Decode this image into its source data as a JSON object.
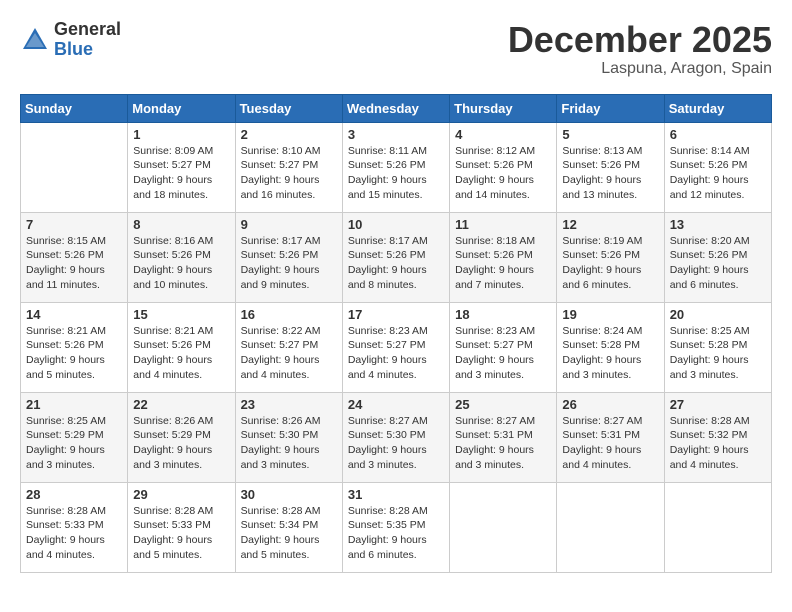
{
  "header": {
    "logo_general": "General",
    "logo_blue": "Blue",
    "month_title": "December 2025",
    "location": "Laspuna, Aragon, Spain"
  },
  "weekdays": [
    "Sunday",
    "Monday",
    "Tuesday",
    "Wednesday",
    "Thursday",
    "Friday",
    "Saturday"
  ],
  "weeks": [
    [
      {
        "day": "",
        "info": ""
      },
      {
        "day": "1",
        "info": "Sunrise: 8:09 AM\nSunset: 5:27 PM\nDaylight: 9 hours\nand 18 minutes."
      },
      {
        "day": "2",
        "info": "Sunrise: 8:10 AM\nSunset: 5:27 PM\nDaylight: 9 hours\nand 16 minutes."
      },
      {
        "day": "3",
        "info": "Sunrise: 8:11 AM\nSunset: 5:26 PM\nDaylight: 9 hours\nand 15 minutes."
      },
      {
        "day": "4",
        "info": "Sunrise: 8:12 AM\nSunset: 5:26 PM\nDaylight: 9 hours\nand 14 minutes."
      },
      {
        "day": "5",
        "info": "Sunrise: 8:13 AM\nSunset: 5:26 PM\nDaylight: 9 hours\nand 13 minutes."
      },
      {
        "day": "6",
        "info": "Sunrise: 8:14 AM\nSunset: 5:26 PM\nDaylight: 9 hours\nand 12 minutes."
      }
    ],
    [
      {
        "day": "7",
        "info": "Sunrise: 8:15 AM\nSunset: 5:26 PM\nDaylight: 9 hours\nand 11 minutes."
      },
      {
        "day": "8",
        "info": "Sunrise: 8:16 AM\nSunset: 5:26 PM\nDaylight: 9 hours\nand 10 minutes."
      },
      {
        "day": "9",
        "info": "Sunrise: 8:17 AM\nSunset: 5:26 PM\nDaylight: 9 hours\nand 9 minutes."
      },
      {
        "day": "10",
        "info": "Sunrise: 8:17 AM\nSunset: 5:26 PM\nDaylight: 9 hours\nand 8 minutes."
      },
      {
        "day": "11",
        "info": "Sunrise: 8:18 AM\nSunset: 5:26 PM\nDaylight: 9 hours\nand 7 minutes."
      },
      {
        "day": "12",
        "info": "Sunrise: 8:19 AM\nSunset: 5:26 PM\nDaylight: 9 hours\nand 6 minutes."
      },
      {
        "day": "13",
        "info": "Sunrise: 8:20 AM\nSunset: 5:26 PM\nDaylight: 9 hours\nand 6 minutes."
      }
    ],
    [
      {
        "day": "14",
        "info": "Sunrise: 8:21 AM\nSunset: 5:26 PM\nDaylight: 9 hours\nand 5 minutes."
      },
      {
        "day": "15",
        "info": "Sunrise: 8:21 AM\nSunset: 5:26 PM\nDaylight: 9 hours\nand 4 minutes."
      },
      {
        "day": "16",
        "info": "Sunrise: 8:22 AM\nSunset: 5:27 PM\nDaylight: 9 hours\nand 4 minutes."
      },
      {
        "day": "17",
        "info": "Sunrise: 8:23 AM\nSunset: 5:27 PM\nDaylight: 9 hours\nand 4 minutes."
      },
      {
        "day": "18",
        "info": "Sunrise: 8:23 AM\nSunset: 5:27 PM\nDaylight: 9 hours\nand 3 minutes."
      },
      {
        "day": "19",
        "info": "Sunrise: 8:24 AM\nSunset: 5:28 PM\nDaylight: 9 hours\nand 3 minutes."
      },
      {
        "day": "20",
        "info": "Sunrise: 8:25 AM\nSunset: 5:28 PM\nDaylight: 9 hours\nand 3 minutes."
      }
    ],
    [
      {
        "day": "21",
        "info": "Sunrise: 8:25 AM\nSunset: 5:29 PM\nDaylight: 9 hours\nand 3 minutes."
      },
      {
        "day": "22",
        "info": "Sunrise: 8:26 AM\nSunset: 5:29 PM\nDaylight: 9 hours\nand 3 minutes."
      },
      {
        "day": "23",
        "info": "Sunrise: 8:26 AM\nSunset: 5:30 PM\nDaylight: 9 hours\nand 3 minutes."
      },
      {
        "day": "24",
        "info": "Sunrise: 8:27 AM\nSunset: 5:30 PM\nDaylight: 9 hours\nand 3 minutes."
      },
      {
        "day": "25",
        "info": "Sunrise: 8:27 AM\nSunset: 5:31 PM\nDaylight: 9 hours\nand 3 minutes."
      },
      {
        "day": "26",
        "info": "Sunrise: 8:27 AM\nSunset: 5:31 PM\nDaylight: 9 hours\nand 4 minutes."
      },
      {
        "day": "27",
        "info": "Sunrise: 8:28 AM\nSunset: 5:32 PM\nDaylight: 9 hours\nand 4 minutes."
      }
    ],
    [
      {
        "day": "28",
        "info": "Sunrise: 8:28 AM\nSunset: 5:33 PM\nDaylight: 9 hours\nand 4 minutes."
      },
      {
        "day": "29",
        "info": "Sunrise: 8:28 AM\nSunset: 5:33 PM\nDaylight: 9 hours\nand 5 minutes."
      },
      {
        "day": "30",
        "info": "Sunrise: 8:28 AM\nSunset: 5:34 PM\nDaylight: 9 hours\nand 5 minutes."
      },
      {
        "day": "31",
        "info": "Sunrise: 8:28 AM\nSunset: 5:35 PM\nDaylight: 9 hours\nand 6 minutes."
      },
      {
        "day": "",
        "info": ""
      },
      {
        "day": "",
        "info": ""
      },
      {
        "day": "",
        "info": ""
      }
    ]
  ]
}
